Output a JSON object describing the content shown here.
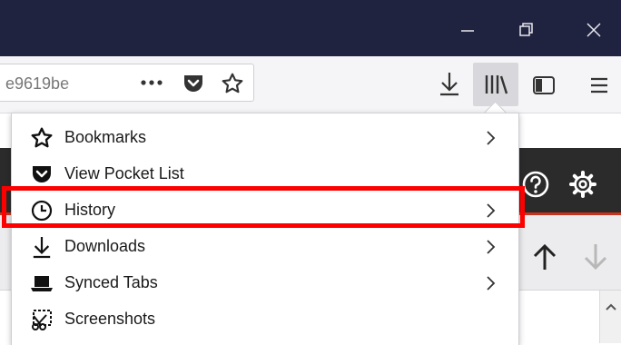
{
  "window": {
    "controls": [
      "minimize",
      "restore",
      "close"
    ]
  },
  "toolbar": {
    "url_text": "e9619be",
    "page_actions_icon": "more-dots-icon",
    "pocket_icon": "pocket-icon",
    "bookmark_icon": "star-icon",
    "downloads_icon": "download-arrow-icon",
    "library_icon": "library-icon",
    "sidebar_icon": "sidebar-icon",
    "menu_icon": "hamburger-icon"
  },
  "library_menu": {
    "items": [
      {
        "label": "Bookmarks",
        "icon": "star-icon",
        "has_submenu": true
      },
      {
        "label": "View Pocket List",
        "icon": "pocket-icon",
        "has_submenu": false
      },
      {
        "label": "History",
        "icon": "clock-icon",
        "has_submenu": true,
        "highlighted": true
      },
      {
        "label": "Downloads",
        "icon": "download-arrow-icon",
        "has_submenu": true
      },
      {
        "label": "Synced Tabs",
        "icon": "laptop-icon",
        "has_submenu": true
      },
      {
        "label": "Screenshots",
        "icon": "scissors-icon",
        "has_submenu": false
      }
    ]
  },
  "page_behind": {
    "icons": [
      "help-icon",
      "gear-icon",
      "arrow-up-icon",
      "arrow-down-icon",
      "scroll-up-icon"
    ]
  },
  "colors": {
    "titlebar": "#202340",
    "highlight_outline": "#ff0000",
    "page_accent": "#c8321e"
  }
}
